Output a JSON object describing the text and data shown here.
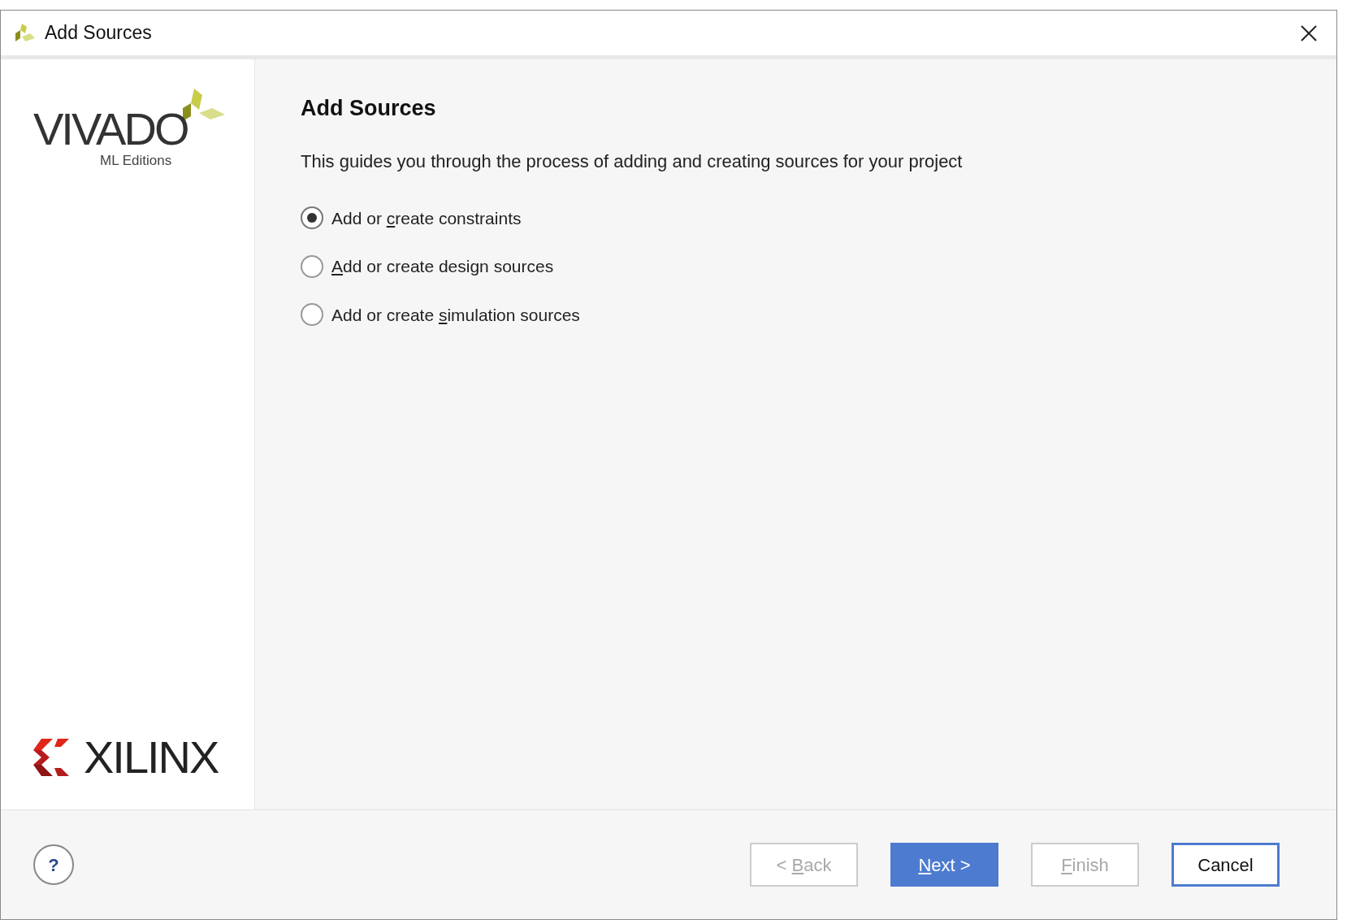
{
  "window": {
    "title": "Add Sources"
  },
  "sidebar": {
    "product_name": "VIVADO",
    "product_edition": "ML Editions",
    "vendor_name": "XILINX"
  },
  "page": {
    "heading": "Add Sources",
    "description": "This guides you through the process of adding and creating sources for your project"
  },
  "options": [
    {
      "before": "Add or ",
      "key": "c",
      "after": "reate constraints",
      "selected": true
    },
    {
      "key": "A",
      "after": "dd or create design sources",
      "selected": false
    },
    {
      "before": "Add or create ",
      "key": "s",
      "after": "imulation sources",
      "selected": false
    }
  ],
  "footer": {
    "help": "?"
  },
  "buttons": [
    {
      "before": "< ",
      "key": "B",
      "after": "ack",
      "kind": "disabled"
    },
    {
      "key": "N",
      "after": "ext >",
      "kind": "primary"
    },
    {
      "key": "F",
      "after": "inish",
      "kind": "disabled"
    },
    {
      "before": "Cancel",
      "kind": "focused"
    }
  ]
}
